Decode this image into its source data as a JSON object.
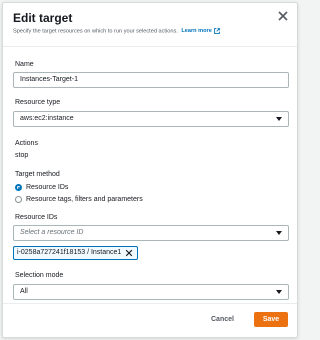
{
  "header": {
    "title": "Edit target",
    "subtitle": "Specify the target resources on which to run your selected actions.",
    "learn_more": "Learn more"
  },
  "fields": {
    "name_label": "Name",
    "name_value": "Instances-Target-1",
    "resource_type_label": "Resource type",
    "resource_type_value": "aws:ec2:instance",
    "actions_label": "Actions",
    "actions_value": "stop",
    "target_method_label": "Target method",
    "target_method_options": [
      {
        "label": "Resource IDs",
        "checked": true
      },
      {
        "label": "Resource tags, filters and parameters",
        "checked": false
      }
    ],
    "resource_ids_label": "Resource IDs",
    "resource_ids_placeholder": "Select a resource ID",
    "resource_ids_tokens": [
      "i-0258a727241f18153 / Instance1"
    ],
    "selection_mode_label": "Selection mode",
    "selection_mode_value": "All"
  },
  "footer": {
    "cancel_label": "Cancel",
    "save_label": "Save"
  },
  "colors": {
    "accent": "#0073bb",
    "primary_button": "#ec7211"
  },
  "icons": {
    "close": "close-icon",
    "external_link": "external-link-icon",
    "dropdown": "chevron-down-icon",
    "remove_token": "remove-token-icon"
  }
}
